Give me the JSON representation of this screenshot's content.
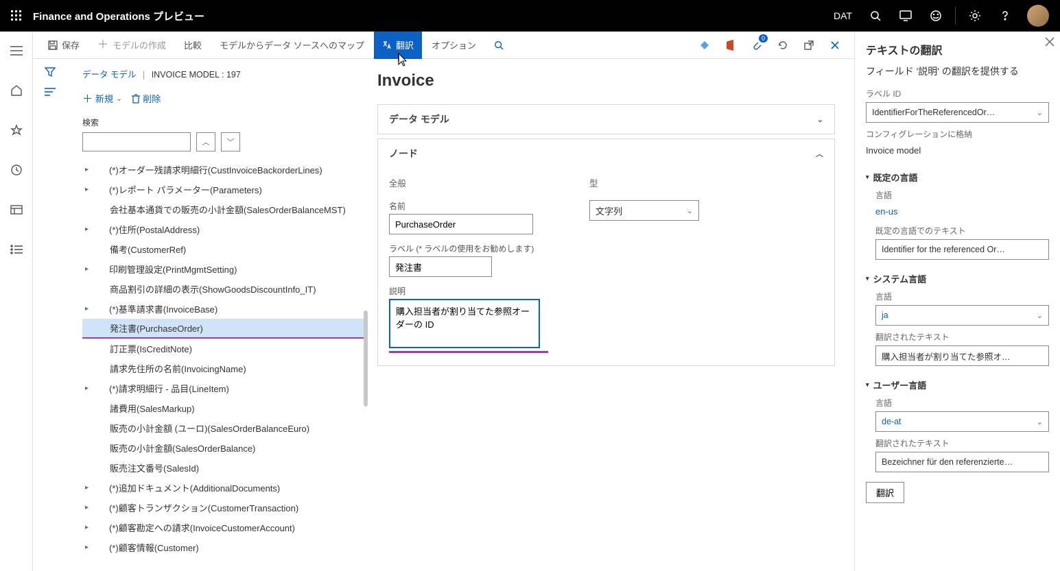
{
  "header": {
    "app_title": "Finance and Operations プレビュー",
    "company": "DAT"
  },
  "toolbar": {
    "save": "保存",
    "create_model": "モデルの作成",
    "compare": "比較",
    "map_model": "モデルからデータ ソースへのマップ",
    "translate": "翻訳",
    "option": "オプション",
    "badge": "0"
  },
  "breadcrumb": {
    "link": "データ モデル",
    "current": "INVOICE MODEL : 197"
  },
  "newdel": {
    "new": "新規",
    "delete": "削除"
  },
  "search": {
    "label": "検索"
  },
  "tree": [
    {
      "exp": true,
      "label": "(*)オーダー残請求明細行(CustInvoiceBackorderLines)"
    },
    {
      "exp": true,
      "label": "(*)レポート パラメーター(Parameters)"
    },
    {
      "exp": false,
      "label": "会社基本通貨での販売の小計金額(SalesOrderBalanceMST)"
    },
    {
      "exp": true,
      "label": "(*)住所(PostalAddress)"
    },
    {
      "exp": false,
      "label": "備考(CustomerRef)"
    },
    {
      "exp": true,
      "label": "印刷管理設定(PrintMgmtSetting)"
    },
    {
      "exp": false,
      "label": "商品割引の詳細の表示(ShowGoodsDiscountInfo_IT)"
    },
    {
      "exp": true,
      "label": "(*)基準請求書(InvoiceBase)"
    },
    {
      "exp": false,
      "label": "発注書(PurchaseOrder)",
      "selected": true
    },
    {
      "exp": false,
      "label": "訂正票(IsCreditNote)"
    },
    {
      "exp": false,
      "label": "請求先住所の名前(InvoicingName)"
    },
    {
      "exp": true,
      "label": "(*)請求明細行 - 品目(LineItem)"
    },
    {
      "exp": false,
      "label": "諸費用(SalesMarkup)"
    },
    {
      "exp": false,
      "label": "販売の小計金額 (ユーロ)(SalesOrderBalanceEuro)"
    },
    {
      "exp": false,
      "label": "販売の小計金額(SalesOrderBalance)"
    },
    {
      "exp": false,
      "label": "販売注文番号(SalesId)"
    },
    {
      "exp": true,
      "label": "(*)追加ドキュメント(AdditionalDocuments)"
    },
    {
      "exp": true,
      "label": "(*)顧客トランザクション(CustomerTransaction)"
    },
    {
      "exp": true,
      "label": "(*)顧客勘定への請求(InvoiceCustomerAccount)"
    },
    {
      "exp": true,
      "label": "(*)顧客情報(Customer)"
    }
  ],
  "detail": {
    "heading": "Invoice",
    "card_datamodel": "データ モデル",
    "card_node": "ノード",
    "general": "全般",
    "name_label": "名前",
    "name_value": "PurchaseOrder",
    "label_label": "ラベル (* ラベルの使用をお勧めします)",
    "label_value": "発注書",
    "desc_label": "説明",
    "desc_value": "購入担当者が割り当てた参照オーダーの ID",
    "type_header": "型",
    "type_value": "文字列"
  },
  "rpanel": {
    "title": "テキストの翻訳",
    "subtitle": "フィールド '説明' の翻訳を提供する",
    "labelid_label": "ラベル ID",
    "labelid_value": "IdentifierForTheReferencedOr…",
    "stored_label": "コンフィグレーションに格納",
    "stored_value": "Invoice model",
    "sec_default": "既定の言語",
    "lang_label": "言語",
    "lang_default": "en-us",
    "default_text_label": "既定の言語でのテキスト",
    "default_text_value": "Identifier for the referenced Or…",
    "sec_system": "システム言語",
    "lang_system": "ja",
    "trans_text_label": "翻訳されたテキスト",
    "trans_text_system": "購入担当者が割り当てた参照オ…",
    "sec_user": "ユーザー言語",
    "lang_user": "de-at",
    "trans_text_user": "Bezeichner für den referenzierte…",
    "btn": "翻訳"
  }
}
